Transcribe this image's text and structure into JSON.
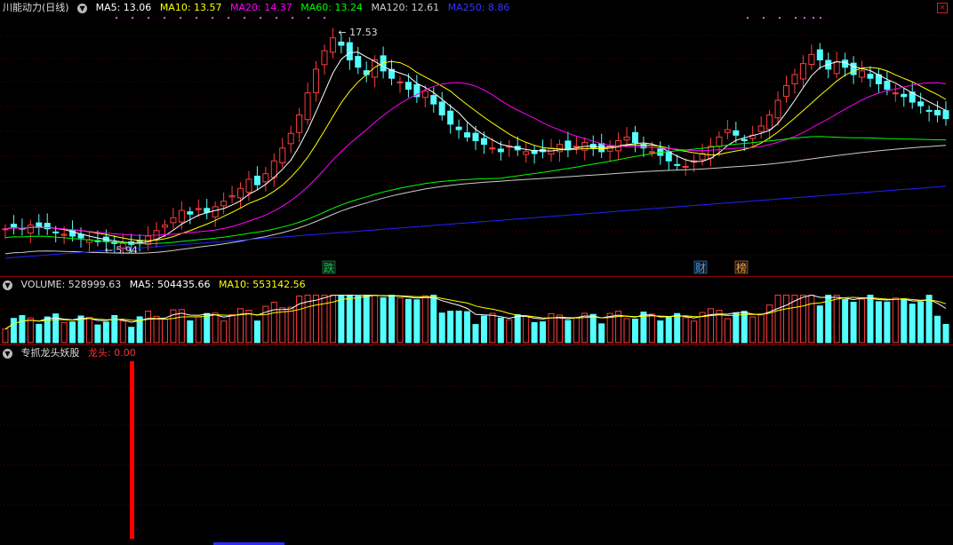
{
  "main": {
    "stock_name": "川能动力(日线)",
    "ma_labels": [
      {
        "label": "MA5: 13.06",
        "color": "#ffffff"
      },
      {
        "label": "MA10: 13.57",
        "color": "#ffff00"
      },
      {
        "label": "MA20: 14.37",
        "color": "#ff00ff"
      },
      {
        "label": "MA60: 13.24",
        "color": "#00ff00"
      },
      {
        "label": "MA120: 12.61",
        "color": "#cccccc"
      },
      {
        "label": "MA250: 8.86",
        "color": "#2222ff"
      }
    ],
    "high_label": "17.53",
    "low_label": "5.94",
    "markers": [
      {
        "label": "跌",
        "color": "#00cc44"
      },
      {
        "label": "财",
        "color": "#3aa0ff"
      },
      {
        "label": "榜",
        "color": "#ff9933"
      }
    ]
  },
  "volume": {
    "title": "VOLUME: 528999.63",
    "ma5": "MA5: 504435.66",
    "ma10": "MA10: 553142.56"
  },
  "indicator": {
    "title": "专抓龙头妖股",
    "value_label": "龙头: 0.00"
  },
  "colors": {
    "up": "#ff3c3c",
    "down": "#54ffff",
    "grid": "#5a0000",
    "signal": "#ff0000"
  },
  "chart_data": [
    {
      "type": "candlestick",
      "title": "川能动力(日线)",
      "price_range": [
        5.0,
        18.2
      ],
      "annotated_high": 17.53,
      "annotated_low": 5.94,
      "closes": [
        6.8,
        6.9,
        6.8,
        7.0,
        6.9,
        6.8,
        6.6,
        6.5,
        6.4,
        6.3,
        6.2,
        6.1,
        6.1,
        6.0,
        6.0,
        5.95,
        6.1,
        6.4,
        6.7,
        7.0,
        7.4,
        7.8,
        7.6,
        7.9,
        7.7,
        8.0,
        8.3,
        8.6,
        9.0,
        9.5,
        9.2,
        9.8,
        10.5,
        11.2,
        12.0,
        13.0,
        14.2,
        15.5,
        16.5,
        17.2,
        16.8,
        16.0,
        15.6,
        15.2,
        16.0,
        15.4,
        15.0,
        14.8,
        14.4,
        14.0,
        14.3,
        13.6,
        13.0,
        12.5,
        12.2,
        11.8,
        11.6,
        11.4,
        11.2,
        11.0,
        11.3,
        11.1,
        11.0,
        10.9,
        11.0,
        11.2,
        11.4,
        11.1,
        11.3,
        11.5,
        11.2,
        11.0,
        11.3,
        11.6,
        11.8,
        11.5,
        11.2,
        11.0,
        10.8,
        10.5,
        10.3,
        10.2,
        10.5,
        10.9,
        11.3,
        11.8,
        12.2,
        11.9,
        11.6,
        11.9,
        12.4,
        13.0,
        13.8,
        14.6,
        15.2,
        15.8,
        16.3,
        16.0,
        15.5,
        15.9,
        15.6,
        15.2,
        15.4,
        15.0,
        14.7,
        14.4,
        14.2,
        14.0,
        13.7,
        13.5,
        13.2,
        13.0,
        12.8
      ],
      "series": [
        {
          "name": "MA5",
          "value": 13.06,
          "color": "#ffffff"
        },
        {
          "name": "MA10",
          "value": 13.57,
          "color": "#ffff00"
        },
        {
          "name": "MA20",
          "value": 14.37,
          "color": "#ff00ff"
        },
        {
          "name": "MA60",
          "value": 13.24,
          "color": "#00ff00"
        },
        {
          "name": "MA120",
          "value": 12.61,
          "color": "#cccccc"
        },
        {
          "name": "MA250",
          "value": 8.86,
          "color": "#2222ff"
        }
      ]
    },
    {
      "type": "bar",
      "title": "VOLUME",
      "last_value": 528999.63,
      "ma5": 504435.66,
      "ma10": 553142.56,
      "ylim": [
        0,
        1100000
      ]
    },
    {
      "type": "bar",
      "title": "专抓龙头妖股",
      "series": [
        {
          "name": "龙头",
          "last_value": 0.0
        }
      ],
      "signal_bars": [
        {
          "index": 20,
          "value": 1.0
        }
      ],
      "ylim": [
        0,
        1.0
      ]
    }
  ]
}
